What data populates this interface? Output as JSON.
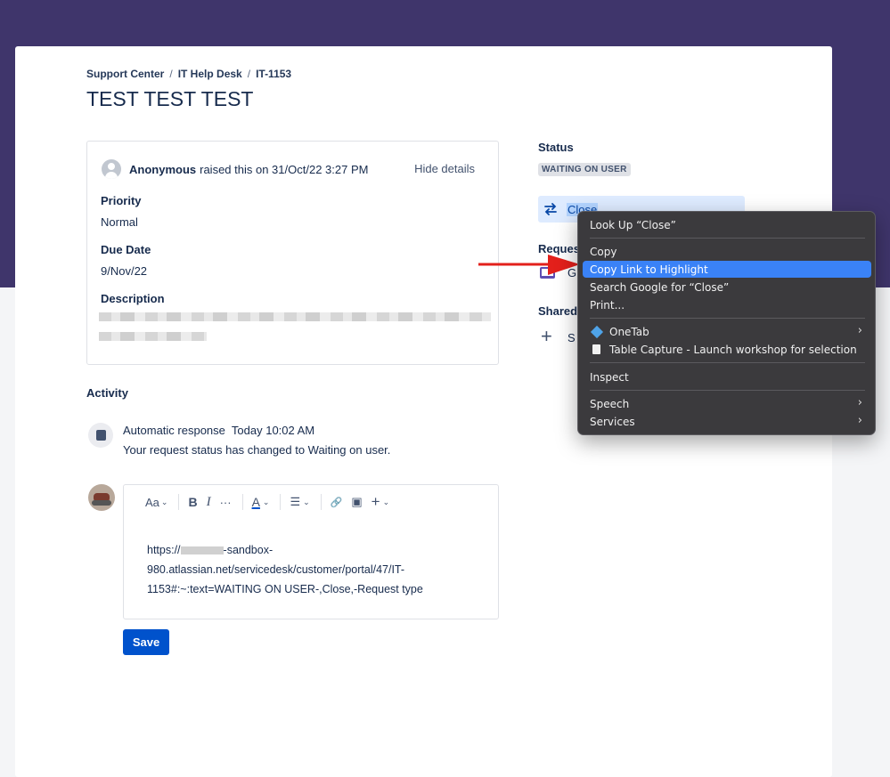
{
  "breadcrumb": {
    "items": [
      "Support Center",
      "IT Help Desk",
      "IT-1153"
    ],
    "separator": "/"
  },
  "page_title": "TEST TEST TEST",
  "request_details": {
    "reporter": "Anonymous",
    "raised_text": "raised this on 31/Oct/22 3:27 PM",
    "hide_details": "Hide details",
    "priority_label": "Priority",
    "priority_value": "Normal",
    "due_date_label": "Due Date",
    "due_date_value": "9/Nov/22",
    "description_label": "Description"
  },
  "activity": {
    "title": "Activity",
    "auto_author": "Automatic response",
    "auto_time": "Today 10:02 AM",
    "auto_message": "Your request status has changed to Waiting on user."
  },
  "editor": {
    "toolbar": {
      "text_style": "Aa",
      "bold": "B",
      "italic": "I",
      "more": "···",
      "text_color": "A",
      "list": "☰",
      "link": "🔗",
      "image": "▣",
      "insert": "+"
    },
    "line1_prefix": "https://",
    "line1_suffix": "-sandbox-",
    "line2": "980.atlassian.net/servicedesk/customer/portal/47/IT-",
    "line3": "1153#:~:text=WAITING ON USER-,Close,-Request type",
    "save_label": "Save"
  },
  "sidebar": {
    "status_label": "Status",
    "status_value": "WAITING ON USER",
    "close_label": "Close",
    "request_type_label": "Reques",
    "request_type_value": "G",
    "shared_label": "Shared",
    "share_value": "S"
  },
  "context_menu": {
    "items": [
      "Look Up “Close”",
      "Copy",
      "Copy Link to Highlight",
      "Search Google for “Close”",
      "Print...",
      "OneTab",
      "Table Capture - Launch workshop for selection",
      "Inspect",
      "Speech",
      "Services"
    ],
    "highlighted": "Copy Link to Highlight",
    "submenu_arrow": "›"
  },
  "colors": {
    "header_band": "#3f356b",
    "primary_button": "#0052cc",
    "menu_highlight": "#3a82f7",
    "annotation_arrow": "#e3201b"
  }
}
